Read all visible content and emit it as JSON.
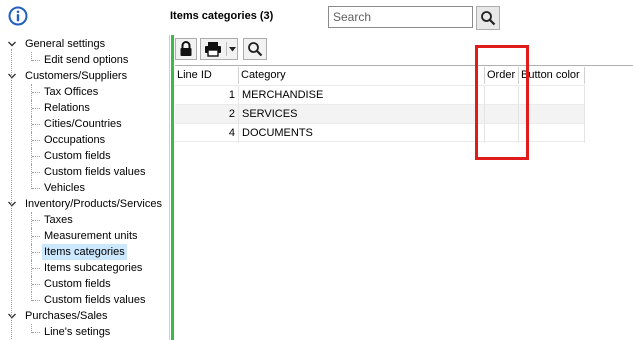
{
  "header": {
    "title": "Items categories (3)",
    "search_placeholder": "Search"
  },
  "tree": [
    {
      "label": "General settings",
      "level": 0,
      "expanded": true
    },
    {
      "label": "Edit send options",
      "level": 1
    },
    {
      "label": "Customers/Suppliers",
      "level": 0,
      "expanded": true
    },
    {
      "label": "Tax Offices",
      "level": 1
    },
    {
      "label": "Relations",
      "level": 1
    },
    {
      "label": "Cities/Countries",
      "level": 1
    },
    {
      "label": "Occupations",
      "level": 1
    },
    {
      "label": "Custom fields",
      "level": 1
    },
    {
      "label": "Custom fields values",
      "level": 1
    },
    {
      "label": "Vehicles",
      "level": 1
    },
    {
      "label": "Inventory/Products/Services",
      "level": 0,
      "expanded": true
    },
    {
      "label": "Taxes",
      "level": 1
    },
    {
      "label": "Measurement units",
      "level": 1
    },
    {
      "label": "Items categories",
      "level": 1,
      "selected": true
    },
    {
      "label": "Items subcategories",
      "level": 1
    },
    {
      "label": "Custom fields",
      "level": 1
    },
    {
      "label": "Custom fields values",
      "level": 1
    },
    {
      "label": "Purchases/Sales",
      "level": 0,
      "expanded": true
    },
    {
      "label": "Line's setings",
      "level": 1
    }
  ],
  "grid": {
    "columns": [
      "Line ID",
      "Category",
      "Order",
      "Button color"
    ],
    "rows": [
      {
        "line_id": "1",
        "category": "MERCHANDISE",
        "order": "",
        "button_color": ""
      },
      {
        "line_id": "2",
        "category": "SERVICES",
        "order": "",
        "button_color": ""
      },
      {
        "line_id": "4",
        "category": "DOCUMENTS",
        "order": "",
        "button_color": ""
      }
    ]
  },
  "icons": {
    "info": "info-circle-icon",
    "search": "magnifier-icon",
    "lock": "lock-icon",
    "print": "printer-icon",
    "dropdown": "caret-down-icon",
    "zoom": "magnifier-icon"
  },
  "colors": {
    "info_blue": "#1f5fbf",
    "accent_green": "#3cb94a",
    "selection": "#cce8ff",
    "highlight_red": "#e01b1b"
  }
}
